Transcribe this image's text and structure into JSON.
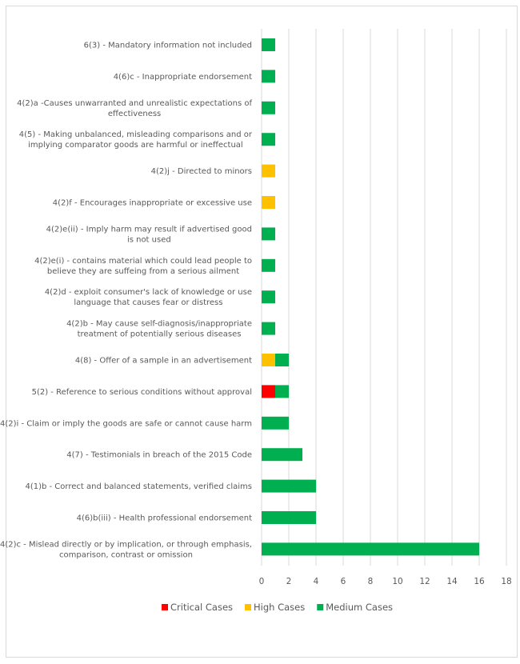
{
  "chart_data": {
    "type": "bar",
    "orientation": "horizontal",
    "stacked": true,
    "title": "",
    "xlabel": "",
    "ylabel": "",
    "xlim": [
      0,
      18
    ],
    "xticks": [
      0,
      2,
      4,
      6,
      8,
      10,
      12,
      14,
      16,
      18
    ],
    "xtick_labels": [
      "0",
      "2",
      "4",
      "6",
      "8",
      "10",
      "12",
      "14",
      "16",
      "18"
    ],
    "grid": "vertical",
    "legend_position": "bottom",
    "categories": [
      [
        "6(3) - Mandatory information not included"
      ],
      [
        "4(6)c - Inappropriate endorsement"
      ],
      [
        "4(2)a -Causes unwarranted and unrealistic expectations of",
        "effectiveness"
      ],
      [
        "4(5) - Making unbalanced, misleading comparisons and or",
        "implying comparator goods are harmful or ineffectual"
      ],
      [
        "4(2)j - Directed to minors"
      ],
      [
        "4(2)f - Encourages inappropriate or excessive use"
      ],
      [
        "4(2)e(ii) - Imply harm may result if advertised good",
        "is not used"
      ],
      [
        "4(2)e(i) - contains material which could lead people to",
        "believe they are suffeing from a serious ailment"
      ],
      [
        "4(2)d - exploit consumer's lack of knowledge or use",
        "language that causes fear or distress"
      ],
      [
        "4(2)b - May cause self-diagnosis/inappropriate",
        "treatment of potentially serious diseases"
      ],
      [
        "4(8) - Offer of a sample in an advertisement"
      ],
      [
        "5(2) - Reference to serious conditions without approval"
      ],
      [
        "4(2)i - Claim or imply the goods are safe or cannot cause harm"
      ],
      [
        "4(7) - Testimonials in breach of the 2015 Code"
      ],
      [
        "4(1)b - Correct and balanced statements, verified claims"
      ],
      [
        "4(6)b(iii) - Health professional endorsement"
      ],
      [
        "4(2)c - Mislead directly or by implication, or through emphasis,",
        "comparison, contrast or omission"
      ]
    ],
    "series": [
      {
        "name": "Critical Cases",
        "color": "#ff0000",
        "values": [
          0,
          0,
          0,
          0,
          0,
          0,
          0,
          0,
          0,
          0,
          0,
          1,
          0,
          0,
          0,
          0,
          0
        ]
      },
      {
        "name": "High Cases",
        "color": "#ffc000",
        "values": [
          0,
          0,
          0,
          0,
          1,
          1,
          0,
          0,
          0,
          0,
          1,
          0,
          0,
          0,
          0,
          0,
          0
        ]
      },
      {
        "name": "Medium Cases",
        "color": "#00b050",
        "values": [
          1,
          1,
          1,
          1,
          0,
          0,
          1,
          1,
          1,
          1,
          1,
          1,
          2,
          3,
          4,
          4,
          16
        ]
      }
    ]
  },
  "colors": {
    "gridline": "#d9d9d9",
    "text": "#595959",
    "frame": "#d9d9d9"
  }
}
